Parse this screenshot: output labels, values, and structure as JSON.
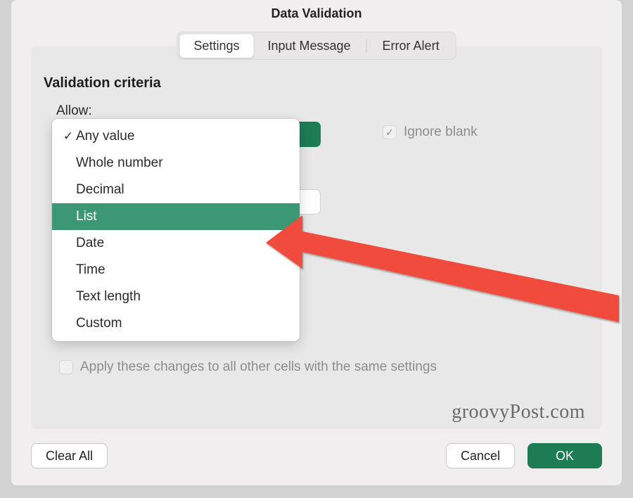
{
  "colors": {
    "accent": "#1d7c54",
    "highlight": "#3c9774",
    "arrow": "#f04b3c"
  },
  "title": "Data Validation",
  "tabs": {
    "settings": "Settings",
    "input_message": "Input Message",
    "error_alert": "Error Alert"
  },
  "section": {
    "heading": "Validation criteria",
    "allow_label": "Allow:"
  },
  "checkboxes": {
    "ignore_blank": "Ignore blank",
    "apply_changes": "Apply these changes to all other cells with the same settings"
  },
  "dropdown": {
    "options": [
      "Any value",
      "Whole number",
      "Decimal",
      "List",
      "Date",
      "Time",
      "Text length",
      "Custom"
    ],
    "selected": "Any value",
    "highlighted": "List"
  },
  "buttons": {
    "clear_all": "Clear All",
    "cancel": "Cancel",
    "ok": "OK"
  },
  "watermark": "groovyPost.com"
}
